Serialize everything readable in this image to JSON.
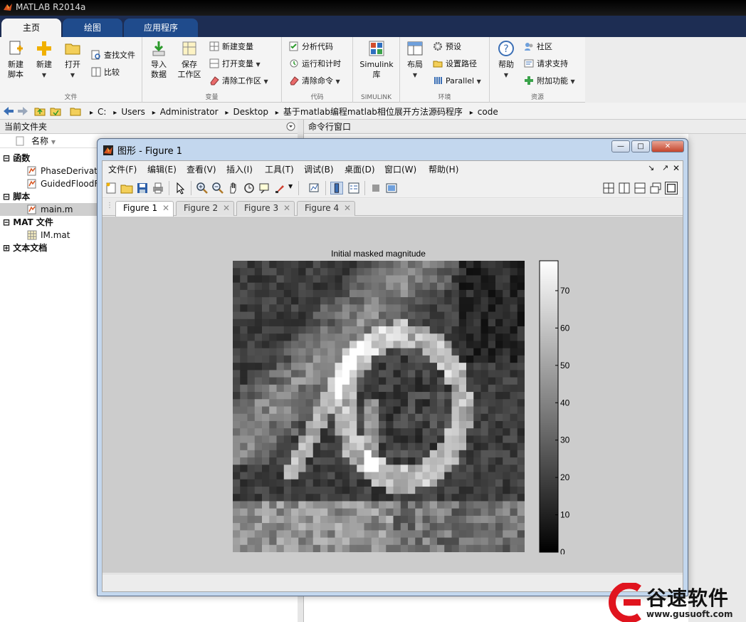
{
  "app": {
    "title": "MATLAB R2014a"
  },
  "ribbon_tabs": [
    "主页",
    "绘图",
    "应用程序"
  ],
  "ribbon": {
    "file": {
      "caption": "文件",
      "new_script": "新建\n脚本",
      "new": "新建",
      "open": "打开",
      "find_files": "查找文件",
      "compare": "比较"
    },
    "variable": {
      "caption": "变量",
      "import": "导入\n数据",
      "save_ws": "保存\n工作区",
      "new_var": "新建变量",
      "open_var": "打开变量",
      "clear_ws": "清除工作区"
    },
    "code": {
      "caption": "代码",
      "analyze": "分析代码",
      "run_time": "运行和计时",
      "clear_cmd": "清除命令"
    },
    "simulink": {
      "caption": "SIMULINK",
      "label": "Simulink\n库"
    },
    "env": {
      "caption": "环境",
      "layout": "布局",
      "prefs": "预设",
      "set_path": "设置路径",
      "parallel": "Parallel"
    },
    "resources": {
      "caption": "资源",
      "help": "帮助",
      "community": "社区",
      "support": "请求支持",
      "addons": "附加功能"
    }
  },
  "address": {
    "crumbs": [
      "C:",
      "Users",
      "Administrator",
      "Desktop",
      "基于matlab编程matlab相位展开方法源码程序",
      "code"
    ]
  },
  "current_folder": {
    "header": "当前文件夹",
    "name_col": "名称",
    "rows": [
      {
        "label": "函数",
        "bold": true
      },
      {
        "label": "PhaseDerivati"
      },
      {
        "label": "GuidedFloodF"
      },
      {
        "label": "脚本",
        "bold": true
      },
      {
        "label": "main.m"
      },
      {
        "label": "MAT 文件",
        "bold": true
      },
      {
        "label": "IM.mat"
      },
      {
        "label": "文本文档",
        "bold": true
      }
    ]
  },
  "command_window": {
    "header": "命令行窗口"
  },
  "figure": {
    "window_title": "图形 - Figure 1",
    "menus": [
      "文件(F)",
      "编辑(E)",
      "查看(V)",
      "插入(I)",
      "工具(T)",
      "调试(B)",
      "桌面(D)",
      "窗口(W)",
      "帮助(H)"
    ],
    "tabs": [
      "Figure 1",
      "Figure 2",
      "Figure 3",
      "Figure 4"
    ],
    "active_tab": "Figure 1",
    "plot_title": "Initial masked magnitude",
    "colorbar": {
      "ticks": [
        "0",
        "10",
        "20",
        "30",
        "40",
        "50",
        "60",
        "70"
      ]
    }
  },
  "chart_data": {
    "type": "heatmap",
    "title": "Initial masked magnitude",
    "colormap": "gray",
    "clim": [
      0,
      78
    ],
    "colorbar_ticks": [
      0,
      10,
      20,
      30,
      40,
      50,
      60,
      70
    ]
  },
  "watermark": {
    "text": "谷速软件",
    "url": "www.gusuoft.com"
  }
}
